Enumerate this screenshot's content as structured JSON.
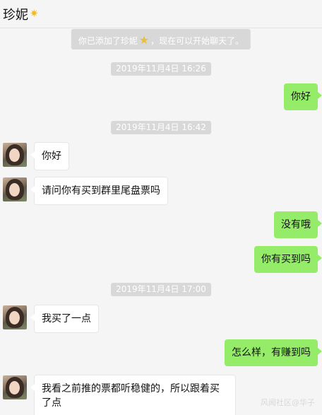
{
  "header": {
    "title": "珍妮",
    "title_icon": "star-icon"
  },
  "system_notice": {
    "before": "你已添加了珍妮",
    "after": "，现在可以开始聊天了。"
  },
  "timestamps": [
    "2019年11月4日 16:26",
    "2019年11月4日 16:42",
    "2019年11月4日 17:00"
  ],
  "messages": [
    {
      "side": "out",
      "text": "你好"
    },
    {
      "side": "in",
      "text": "你好"
    },
    {
      "side": "in",
      "text": "请问你有买到群里尾盘票吗"
    },
    {
      "side": "out",
      "text": "没有哦"
    },
    {
      "side": "out",
      "text": "你有买到吗"
    },
    {
      "side": "in",
      "text": "我买了一点"
    },
    {
      "side": "out",
      "text": "怎么样，有赚到吗"
    },
    {
      "side": "in",
      "text": "我看之前推的票都听稳健的，所以跟着买了点"
    }
  ],
  "watermark": "风闻社区@华子",
  "colors": {
    "background": "#f5f5f5",
    "out_bubble": "#95ec69",
    "in_bubble": "#ffffff",
    "system": "#d8d8d8"
  }
}
